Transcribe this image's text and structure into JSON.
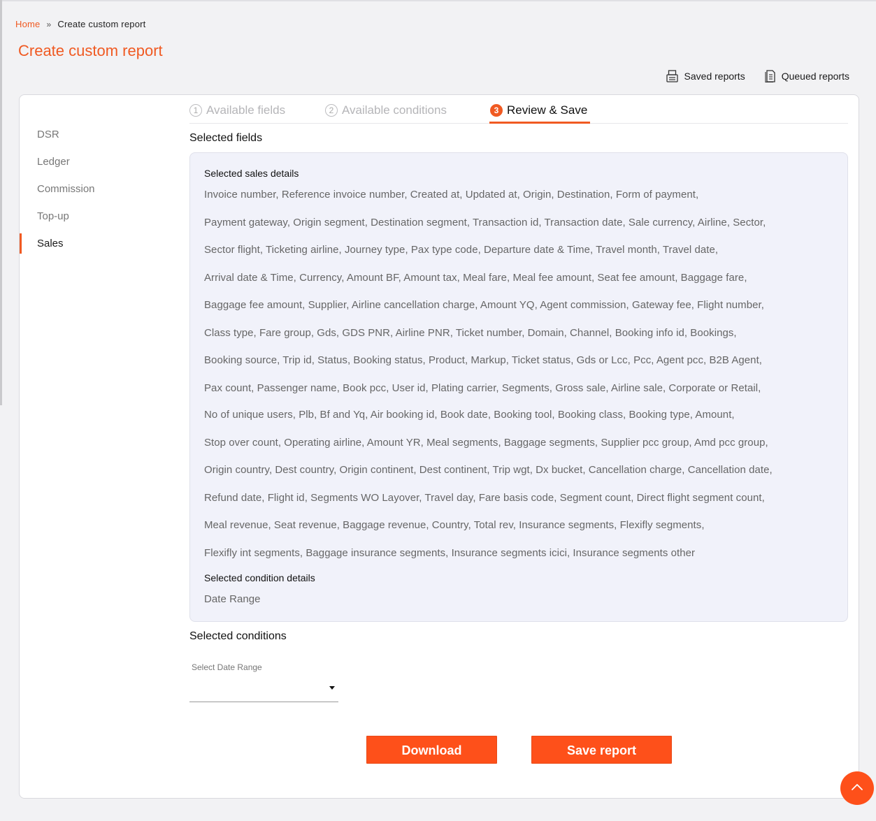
{
  "breadcrumb": {
    "home": "Home",
    "current": "Create custom report"
  },
  "page_title": "Create custom report",
  "top_links": {
    "saved": "Saved reports",
    "queued": "Queued reports"
  },
  "sidebar": {
    "items": [
      {
        "label": "DSR"
      },
      {
        "label": "Ledger"
      },
      {
        "label": "Commission"
      },
      {
        "label": "Top-up"
      },
      {
        "label": "Sales",
        "active": true
      }
    ]
  },
  "tabs": [
    {
      "num": "1",
      "label": "Available fields"
    },
    {
      "num": "2",
      "label": "Available conditions"
    },
    {
      "num": "3",
      "label": "Review & Save",
      "active": true
    }
  ],
  "selected_fields_title": "Selected fields",
  "sales_details_title": "Selected sales details",
  "sales_fields_lines": [
    "Invoice number,  Reference invoice number,  Created at,  Updated at,  Origin,  Destination,  Form of payment,",
    "Payment gateway,  Origin segment,  Destination segment,  Transaction id,  Transaction date,  Sale currency,  Airline,  Sector,",
    "Sector flight,  Ticketing airline,  Journey type,  Pax type code,  Departure date & Time,  Travel month,  Travel date,",
    "Arrival date & Time,  Currency,  Amount BF,  Amount tax,  Meal fare,  Meal fee amount,  Seat fee amount,  Baggage fare,",
    "Baggage fee amount,  Supplier,  Airline cancellation charge,  Amount YQ,  Agent commission,  Gateway fee,  Flight number,",
    "Class type,  Fare group,  Gds,  GDS PNR,  Airline PNR,  Ticket number,  Domain,  Channel,  Booking info id,  Bookings,",
    "Booking source,  Trip id,  Status,  Booking status,  Product,  Markup,  Ticket status,  Gds or Lcc,  Pcc,  Agent pcc,  B2B Agent,",
    "Pax count,  Passenger name,  Book pcc,  User id,  Plating carrier,  Segments,  Gross sale,  Airline sale,  Corporate or Retail,",
    "No of unique users,  Plb,  Bf and Yq,  Air booking id,  Book date,  Booking tool,  Booking class,  Booking type,  Amount,",
    "Stop over count,  Operating airline,  Amount YR,  Meal segments,  Baggage segments,  Supplier pcc group,  Amd pcc group,",
    "Origin country,  Dest country,  Origin continent,  Dest continent,  Trip wgt,  Dx bucket,  Cancellation charge,  Cancellation date,",
    "Refund date,  Flight id,  Segments WO Layover,  Travel day,  Fare basis code,  Segment count,  Direct flight segment count,",
    "Meal revenue,  Seat revenue,  Baggage revenue,  Country,  Total rev,  Insurance segments,  Flexifly segments,",
    "Flexifly int segments,  Baggage insurance segments,  Insurance segments icici,  Insurance segments other"
  ],
  "condition_details_title": "Selected condition details",
  "condition_details_value": "Date Range",
  "selected_conditions_title": "Selected conditions",
  "date_range": {
    "label": "Select Date Range",
    "value": ""
  },
  "buttons": {
    "download": "Download",
    "save": "Save report"
  },
  "colors": {
    "accent": "#f05a22",
    "button": "#fe501a",
    "panel": "#f1f2fa"
  },
  "icons": {
    "saved": "printer-icon",
    "queued": "document-icon",
    "scroll_top": "chevron-up-icon"
  }
}
